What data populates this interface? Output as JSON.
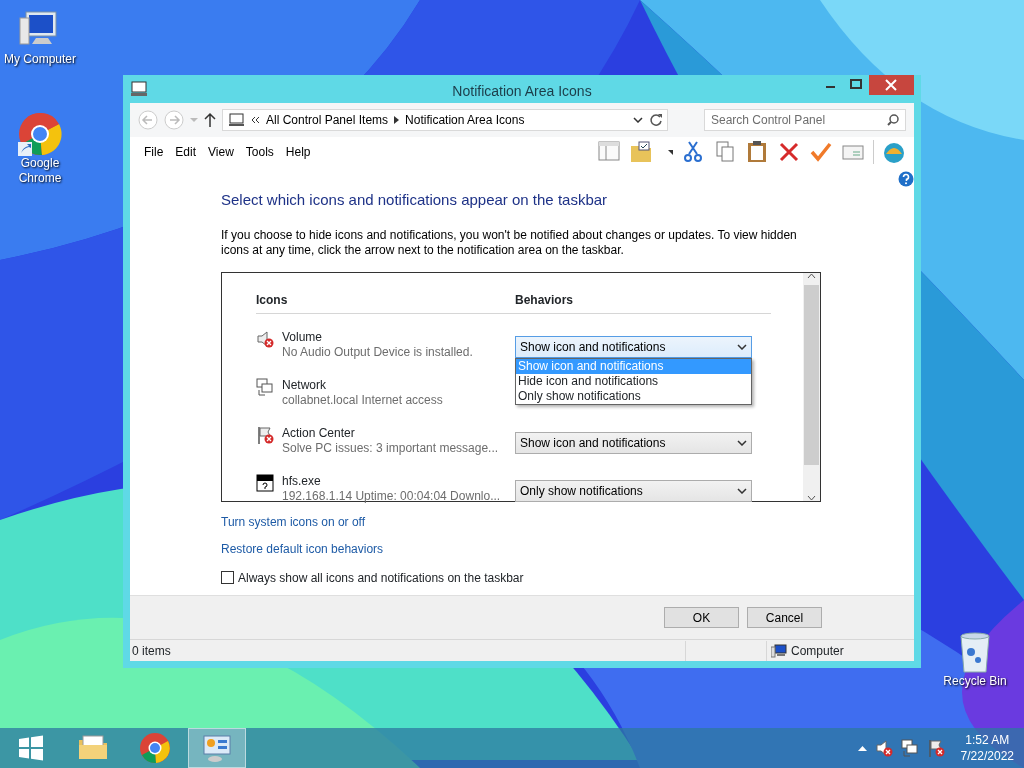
{
  "desktop_icons": [
    {
      "label": "My Computer",
      "kind": "computer"
    },
    {
      "label": "Google Chrome",
      "kind": "chrome"
    },
    {
      "label": "Recycle Bin",
      "kind": "recycle"
    }
  ],
  "window": {
    "title": "Notification Area Icons",
    "address": {
      "breadcrumb": [
        "All Control Panel Items",
        "Notification Area Icons"
      ],
      "search_placeholder": "Search Control Panel"
    },
    "menu": [
      "File",
      "Edit",
      "View",
      "Tools",
      "Help"
    ],
    "heading": "Select which icons and notifications appear on the taskbar",
    "description": "If you choose to hide icons and notifications, you won't be notified about changes or updates. To view hidden icons at any time, click the arrow next to the notification area on the taskbar.",
    "table": {
      "columns": [
        "Icons",
        "Behaviors"
      ],
      "rows": [
        {
          "name": "Volume",
          "detail": "No Audio Output Device is installed.",
          "kind": "volume",
          "behavior": "Show icon and notifications",
          "expanded": true
        },
        {
          "name": "Network",
          "detail": "collabnet.local Internet access",
          "kind": "network"
        },
        {
          "name": "Action Center",
          "detail": "Solve PC issues: 3 important message...",
          "kind": "flag",
          "behavior": "Show icon and notifications",
          "expanded": false
        },
        {
          "name": "hfs.exe",
          "detail": "192.168.1.14 Uptime: 00:04:04 Downlo...",
          "kind": "hfs",
          "behavior": "Only show notifications",
          "expanded": false
        }
      ]
    },
    "dropdown_options": [
      {
        "label": "Show icon and notifications",
        "selected": true
      },
      {
        "label": "Hide icon and notifications",
        "selected": false
      },
      {
        "label": "Only show notifications",
        "selected": false
      }
    ],
    "links": [
      "Turn system icons on or off",
      "Restore default icon behaviors"
    ],
    "checkbox": {
      "label": "Always show all icons and notifications on the taskbar",
      "checked": false
    },
    "buttons": [
      "OK",
      "Cancel"
    ],
    "status_bar": {
      "items": "0 items",
      "location": "Computer"
    }
  },
  "taskbar": {
    "apps": [
      {
        "kind": "explorer",
        "selected": false
      },
      {
        "kind": "chrome",
        "selected": false
      },
      {
        "kind": "control-panel",
        "selected": true
      }
    ],
    "time": "1:52 AM",
    "date": "7/22/2022"
  }
}
